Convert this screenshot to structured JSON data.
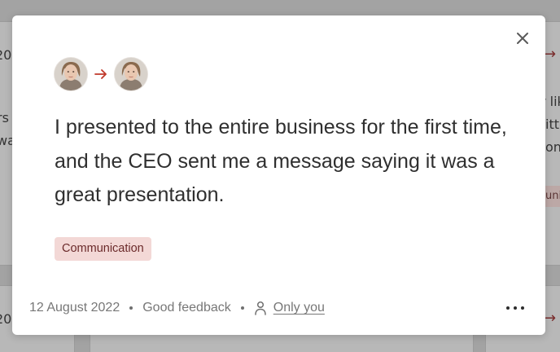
{
  "modal": {
    "close_icon": "close-icon",
    "giver_avatar": "avatar-woman",
    "receiver_avatar": "avatar-woman",
    "arrow_icon": "arrow-right-icon",
    "feedback_text": "I presented to the entire business for the first time, and the CEO sent me a message saying it was a great presentation.",
    "tag_label": "Communication",
    "footer": {
      "date": "12 August 2022",
      "type": "Good feedback",
      "visibility_icon": "person-icon",
      "visibility": "Only you"
    },
    "more_icon": "more-horizontal-icon"
  },
  "background": {
    "left_fragments": [
      "20",
      "rs",
      "wa",
      "20"
    ],
    "right_fragments": [
      "r lik",
      "itte",
      "on",
      "uni"
    ]
  },
  "colors": {
    "accent_arrow": "#c0392b",
    "tag_background": "#f3d8d6",
    "tag_text": "#6b2a2a",
    "text_primary": "#2f2f2f",
    "text_muted": "#777777"
  }
}
